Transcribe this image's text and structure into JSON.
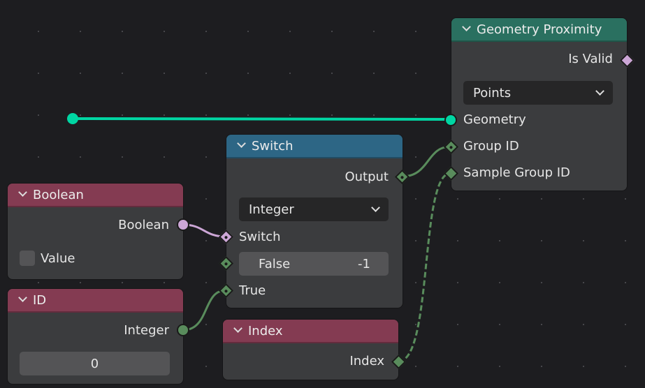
{
  "colors": {
    "background": "#1d1d20",
    "node_body": "#3b3c3e",
    "header_geometry": "#2a7060",
    "header_utility": "#2d6685",
    "header_input": "#843b52",
    "socket_geometry": "#00d6a3",
    "socket_boolean": "#cca6d6",
    "socket_integer": "#598c5c"
  },
  "nodes": {
    "geometry_proximity": {
      "title": "Geometry Proximity",
      "output_is_valid": "Is Valid",
      "mode_dropdown": "Points",
      "input_geometry": "Geometry",
      "input_group_id": "Group ID",
      "input_sample_group_id": "Sample Group ID"
    },
    "switch": {
      "title": "Switch",
      "output": "Output",
      "type_dropdown": "Integer",
      "input_switch": "Switch",
      "false_label": "False",
      "false_value": "-1",
      "input_true": "True"
    },
    "boolean": {
      "title": "Boolean",
      "output": "Boolean",
      "value_label": "Value",
      "value_checked": false
    },
    "id": {
      "title": "ID",
      "output": "Integer",
      "value": "0"
    },
    "index": {
      "title": "Index",
      "output": "Index"
    }
  },
  "links": [
    {
      "from": "reroute",
      "to": "geometry_proximity.Geometry",
      "type": "geometry"
    },
    {
      "from": "boolean.Boolean",
      "to": "switch.Switch",
      "type": "boolean"
    },
    {
      "from": "id.Integer",
      "to": "switch.True",
      "type": "integer"
    },
    {
      "from": "switch.Output",
      "to": "geometry_proximity.Group ID",
      "type": "integer"
    },
    {
      "from": "index.Index",
      "to": "geometry_proximity.Sample Group ID",
      "type": "integer-field"
    }
  ]
}
